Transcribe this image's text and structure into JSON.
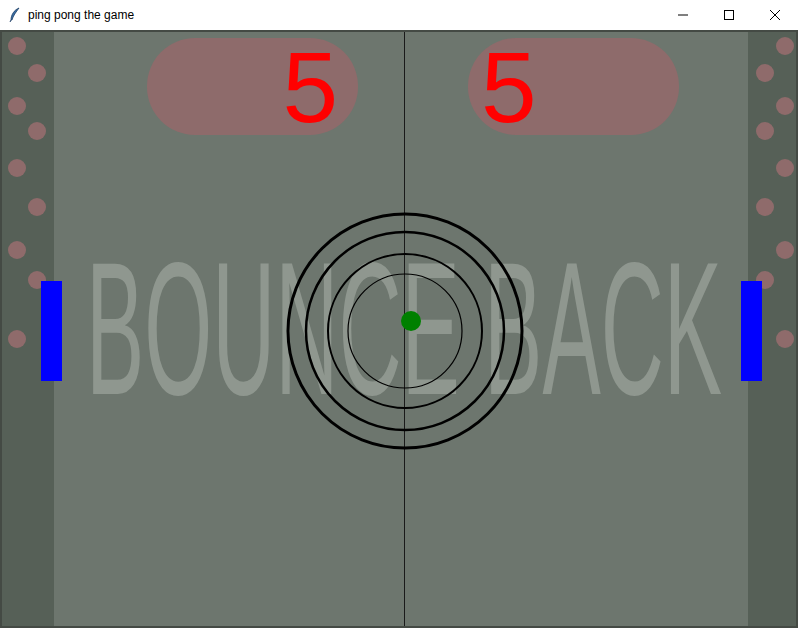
{
  "window": {
    "title": "ping pong the game"
  },
  "scores": [
    "5",
    "5"
  ],
  "watermark": "BOUNCE BACK"
}
